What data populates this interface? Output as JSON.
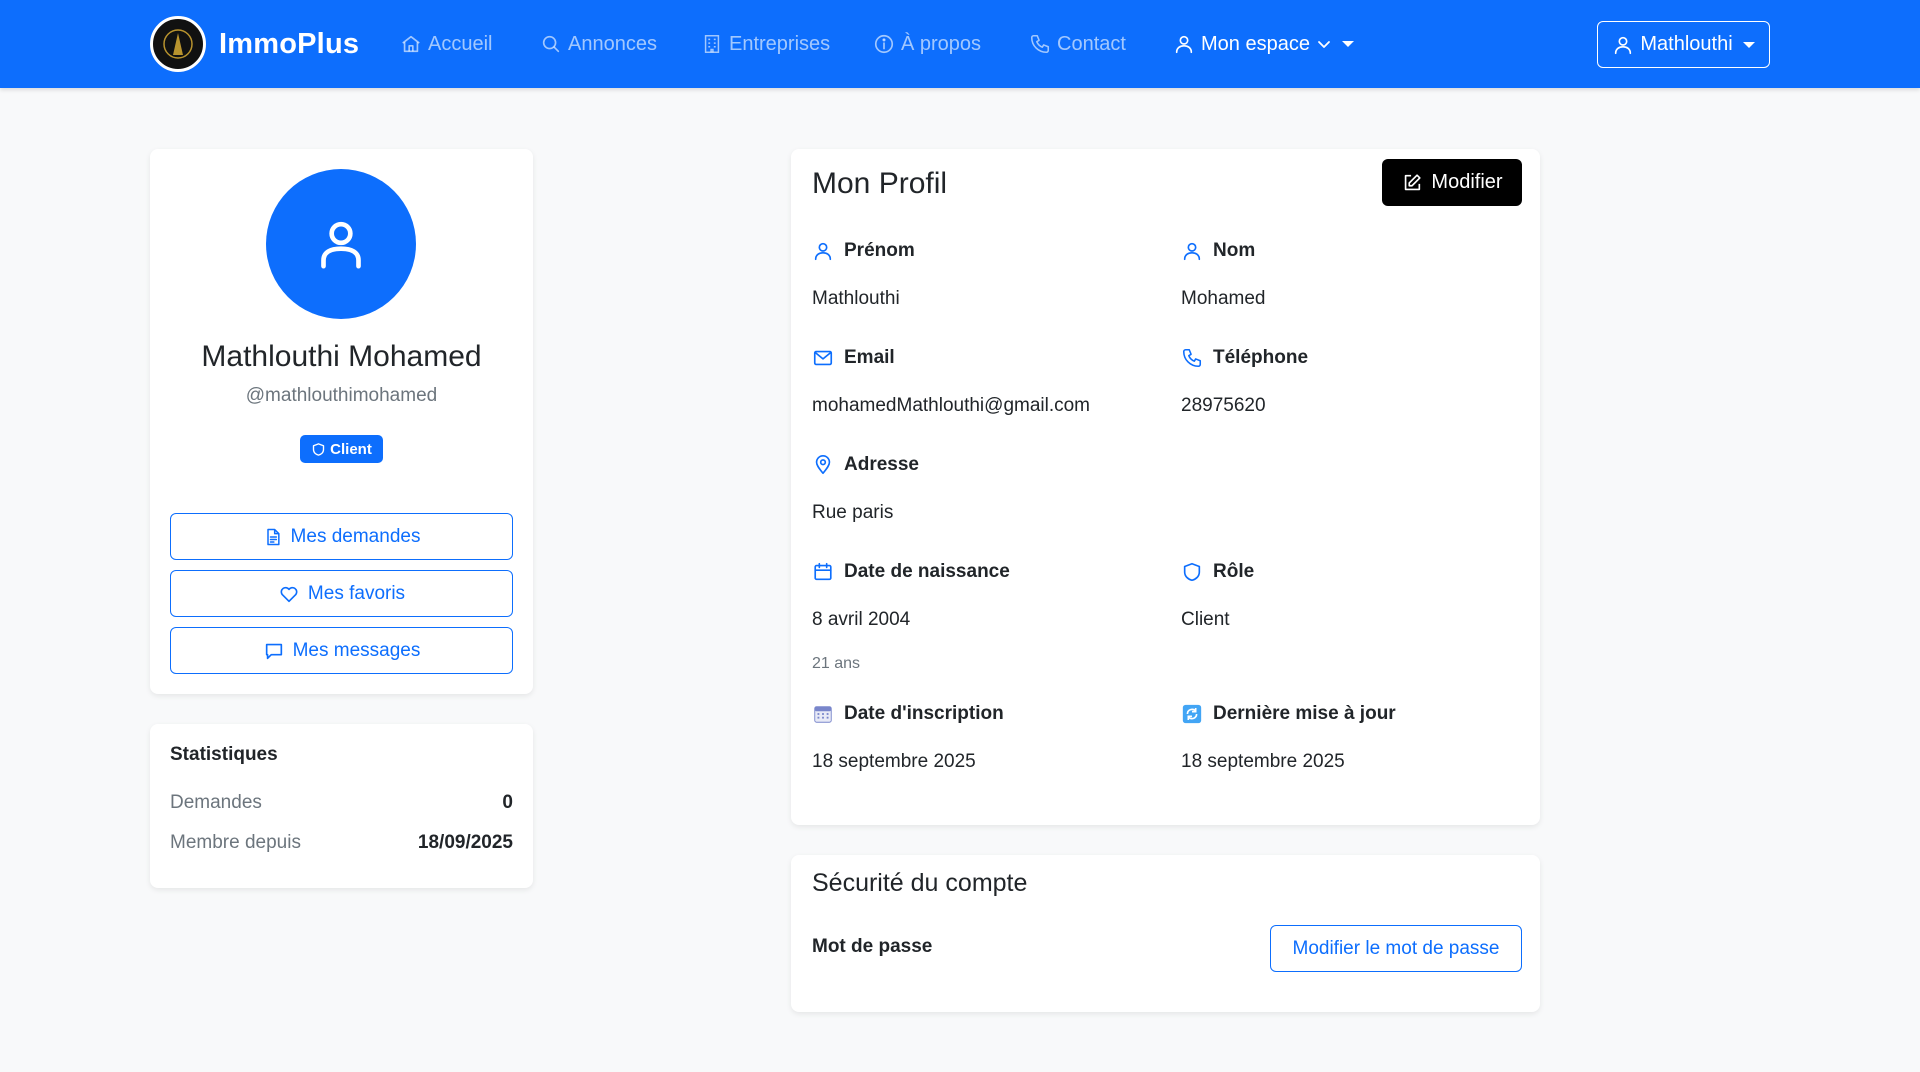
{
  "navbar": {
    "brand": "ImmoPlus",
    "items": [
      {
        "label": "Accueil",
        "icon": "home-icon"
      },
      {
        "label": "Annonces",
        "icon": "search-icon"
      },
      {
        "label": "Entreprises",
        "icon": "building-icon"
      },
      {
        "label": "À propos",
        "icon": "info-icon"
      },
      {
        "label": "Contact",
        "icon": "phone-icon"
      },
      {
        "label": "Mon espace",
        "icon": "user-icon"
      }
    ],
    "user_button": "Mathlouthi"
  },
  "profile": {
    "full_name": "Mathlouthi Mohamed",
    "username": "@mathlouthimohamed",
    "role_badge": "Client",
    "buttons": {
      "requests": "Mes demandes",
      "favorites": "Mes favoris",
      "messages": "Mes messages"
    }
  },
  "stats": {
    "title": "Statistiques",
    "requests_label": "Demandes",
    "requests_value": "0",
    "member_since_label": "Membre depuis",
    "member_since_value": "18/09/2025"
  },
  "info": {
    "title": "Mon Profil",
    "edit_button": "Modifier",
    "first_name_label": "Prénom",
    "first_name": "Mathlouthi",
    "last_name_label": "Nom",
    "last_name": "Mohamed",
    "email_label": "Email",
    "email": "mohamedMathlouthi@gmail.com",
    "phone_label": "Téléphone",
    "phone": "28975620",
    "address_label": "Adresse",
    "address": "Rue paris",
    "birthdate_label": "Date de naissance",
    "birthdate": "8 avril 2004",
    "age": "21 ans",
    "role_label": "Rôle",
    "role": "Client",
    "signup_label": "Date d'inscription",
    "signup_date": "18 septembre 2025",
    "updated_label": "Dernière mise à jour",
    "updated_date": "18 septembre 2025"
  },
  "security": {
    "title": "Sécurité du compte",
    "password_label": "Mot de passe",
    "change_password_button": "Modifier le mot de passe"
  },
  "colors": {
    "primary": "#0d6efd",
    "background": "#f8f9fa",
    "dark_button": "#000000",
    "muted_text": "#6c757d"
  }
}
